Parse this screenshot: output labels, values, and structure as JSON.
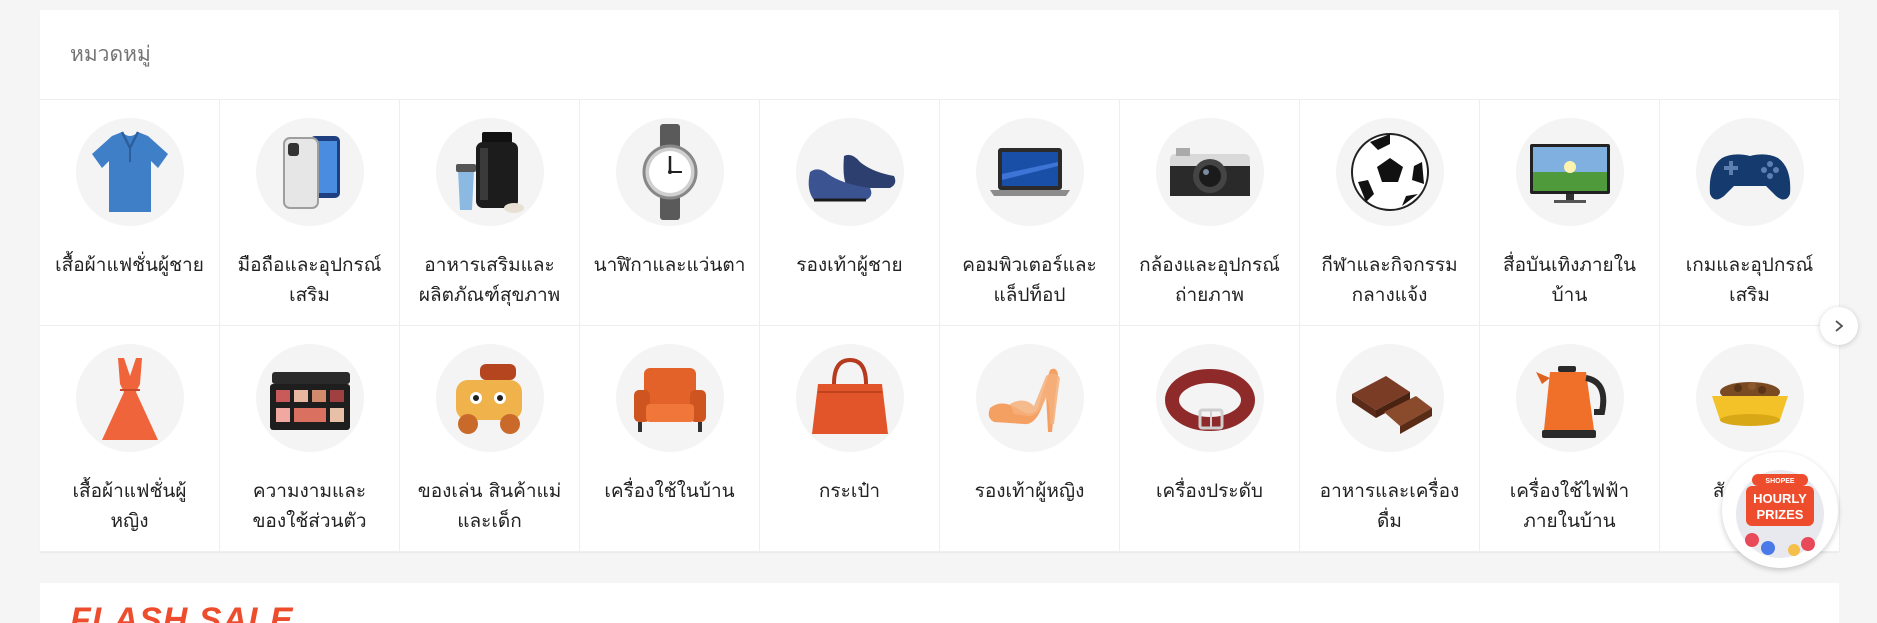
{
  "categories_section": {
    "title": "หมวดหมู่",
    "items": [
      {
        "label": "เสื้อผ้าแฟชั่นผู้ชาย",
        "icon": "polo-shirt-icon"
      },
      {
        "label": "มือถือและอุปกรณ์\nเสริม",
        "icon": "smartphone-icon"
      },
      {
        "label": "อาหารเสริมและ\nผลิตภัณฑ์สุขภาพ",
        "icon": "supplement-jar-icon"
      },
      {
        "label": "นาฬิกาและแว่นตา",
        "icon": "wristwatch-icon"
      },
      {
        "label": "รองเท้าผู้ชาย",
        "icon": "mens-shoe-icon"
      },
      {
        "label": "คอมพิวเตอร์และ\nแล็ปท็อป",
        "icon": "laptop-icon"
      },
      {
        "label": "กล้องและอุปกรณ์\nถ่ายภาพ",
        "icon": "camera-icon"
      },
      {
        "label": "กีฬาและกิจกรรม\nกลางแจ้ง",
        "icon": "soccer-ball-icon"
      },
      {
        "label": "สื่อบันเทิงภายใน\nบ้าน",
        "icon": "television-icon"
      },
      {
        "label": "เกมและอุปกรณ์\nเสริม",
        "icon": "gamepad-icon"
      },
      {
        "label": "เสื้อผ้าแฟชั่นผู้\nหญิง",
        "icon": "dress-icon"
      },
      {
        "label": "ความงามและ\nของใช้ส่วนตัว",
        "icon": "makeup-palette-icon"
      },
      {
        "label": "ของเล่น สินค้าแม่\nและเด็ก",
        "icon": "toy-train-icon"
      },
      {
        "label": "เครื่องใช้ในบ้าน",
        "icon": "armchair-icon"
      },
      {
        "label": "กระเป๋า",
        "icon": "handbag-icon"
      },
      {
        "label": "รองเท้าผู้หญิง",
        "icon": "high-heel-icon"
      },
      {
        "label": "เครื่องประดับ",
        "icon": "belt-icon"
      },
      {
        "label": "อาหารและเครื่อง\nดื่ม",
        "icon": "chocolate-icon"
      },
      {
        "label": "เครื่องใช้ไฟฟ้า\nภายในบ้าน",
        "icon": "kettle-icon"
      },
      {
        "label": "สัตว์เลี้ยง",
        "icon": "pet-bowl-icon"
      }
    ]
  },
  "floating_widget": {
    "brand": "SHOPEE",
    "line1": "HOURLY",
    "line2": "PRIZES"
  },
  "next_section": {
    "title": "FLASH SALE"
  },
  "colors": {
    "brand_orange": "#ee4d2d",
    "page_bg": "#f5f5f5",
    "circle_bg": "#f4f4f5"
  }
}
